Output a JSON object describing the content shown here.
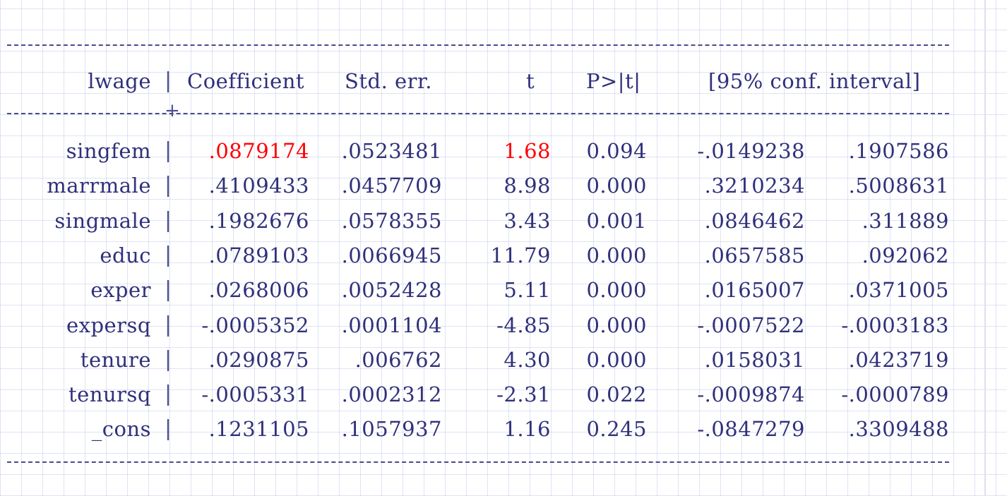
{
  "table": {
    "header": {
      "var": "lwage",
      "coef": "Coefficient",
      "se": "Std. err.",
      "t": "t",
      "p": "P>|t|",
      "ci": "[95% conf. interval]"
    },
    "rows": [
      {
        "var": "singfem",
        "coef": ".0879174",
        "se": ".0523481",
        "t": "1.68",
        "p": "0.094",
        "lo": "-.0149238",
        "hi": ".1907586"
      },
      {
        "var": "marrmale",
        "coef": ".4109433",
        "se": ".0457709",
        "t": "8.98",
        "p": "0.000",
        "lo": ".3210234",
        "hi": ".5008631"
      },
      {
        "var": "singmale",
        "coef": ".1982676",
        "se": ".0578355",
        "t": "3.43",
        "p": "0.001",
        "lo": ".0846462",
        "hi": ".311889"
      },
      {
        "var": "educ",
        "coef": ".0789103",
        "se": ".0066945",
        "t": "11.79",
        "p": "0.000",
        "lo": ".0657585",
        "hi": ".092062"
      },
      {
        "var": "exper",
        "coef": ".0268006",
        "se": ".0052428",
        "t": "5.11",
        "p": "0.000",
        "lo": ".0165007",
        "hi": ".0371005"
      },
      {
        "var": "expersq",
        "coef": "-.0005352",
        "se": ".0001104",
        "t": "-4.85",
        "p": "0.000",
        "lo": "-.0007522",
        "hi": "-.0003183"
      },
      {
        "var": "tenure",
        "coef": ".0290875",
        "se": ".006762",
        "t": "4.30",
        "p": "0.000",
        "lo": ".0158031",
        "hi": ".0423719"
      },
      {
        "var": "tenursq",
        "coef": "-.0005331",
        "se": ".0002312",
        "t": "-2.31",
        "p": "0.022",
        "lo": "-.0009874",
        "hi": "-.0000789"
      },
      {
        "var": "_cons",
        "coef": ".1231105",
        "se": ".1057937",
        "t": "1.16",
        "p": "0.245",
        "lo": "-.0847279",
        "hi": ".3309488"
      }
    ],
    "highlight_color": "#ff0000",
    "text_color": "#30307a"
  }
}
